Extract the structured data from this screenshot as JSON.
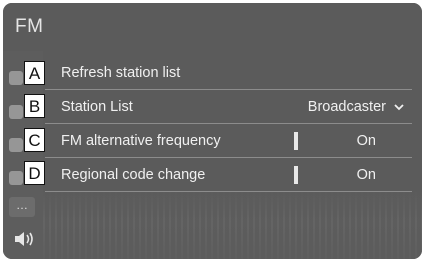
{
  "header": {
    "title": "FM"
  },
  "rows": [
    {
      "badge": "A",
      "label": "Refresh station list"
    },
    {
      "badge": "B",
      "label": "Station List",
      "value": "Broadcaster"
    },
    {
      "badge": "C",
      "label": "FM alternative frequency",
      "value": "On"
    },
    {
      "badge": "D",
      "label": "Regional code change",
      "value": "On"
    }
  ],
  "sidebar": {
    "more_label": "…",
    "more_icon": "more-icon",
    "volume_icon": "volume-icon"
  },
  "colors": {
    "screen_bg": "#5b5b5b",
    "text": "#f0f0f0",
    "divider": "#8c8c8c",
    "badge_bg": "#ffffff"
  }
}
